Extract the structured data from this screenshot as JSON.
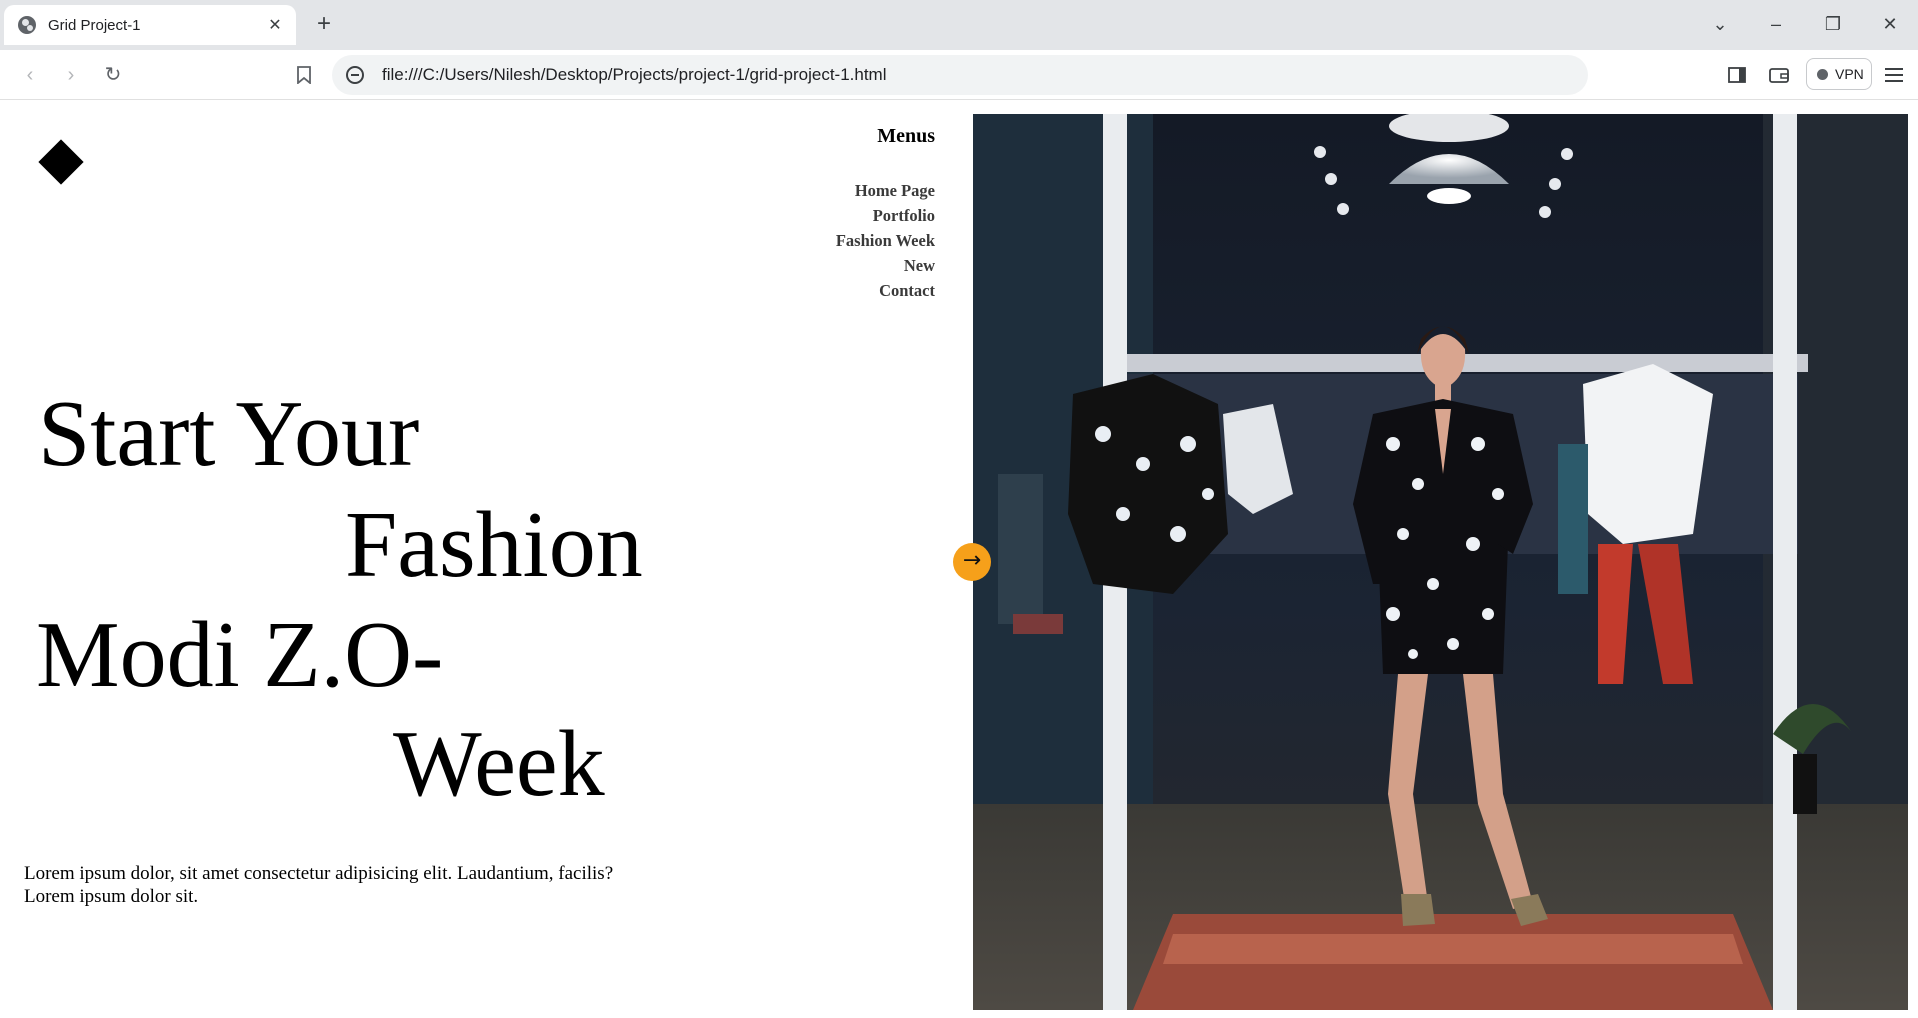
{
  "browser": {
    "tab_title": "Grid Project-1",
    "tab_close": "✕",
    "new_tab": "+",
    "url": "file:///C:/Users/Nilesh/Desktop/Projects/project-1/grid-project-1.html",
    "vpn_label": "VPN",
    "window_controls": {
      "tab_list": "⌄",
      "minimize": "–",
      "restore": "❐",
      "close": "✕"
    },
    "nav": {
      "back": "‹",
      "forward": "›",
      "reload": "↻",
      "bookmark": "☐"
    }
  },
  "menu": {
    "title": "Menus",
    "items": [
      "Home Page",
      "Portfolio",
      "Fashion Week",
      "New",
      "Contact"
    ]
  },
  "hero": {
    "line1": "Start Your",
    "line2": "Fashion",
    "line3": "Modi Z.O-",
    "line4": "Week"
  },
  "body_text": "Lorem ipsum dolor, sit amet consectetur adipisicing elit. Laudantium, facilis? Lorem ipsum dolor sit.",
  "arrow_icon": "→",
  "colors": {
    "accent": "#f6a01a",
    "text": "#000000",
    "menu_link": "#3a3a3a"
  }
}
